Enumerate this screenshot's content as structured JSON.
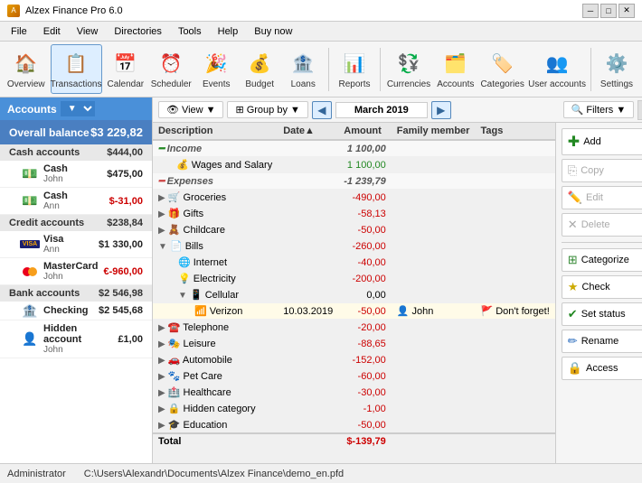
{
  "titleBar": {
    "title": "Alzex Finance Pro 6.0",
    "icon": "A",
    "controls": [
      "─",
      "□",
      "✕"
    ]
  },
  "menuBar": {
    "items": [
      "File",
      "Edit",
      "View",
      "Directories",
      "Tools",
      "Help",
      "Buy now"
    ]
  },
  "toolbar": {
    "buttons": [
      {
        "id": "overview",
        "label": "Overview",
        "icon": "🏠"
      },
      {
        "id": "transactions",
        "label": "Transactions",
        "icon": "📋",
        "active": true
      },
      {
        "id": "calendar",
        "label": "Calendar",
        "icon": "📅"
      },
      {
        "id": "scheduler",
        "label": "Scheduler",
        "icon": "⏰"
      },
      {
        "id": "events",
        "label": "Events",
        "icon": "🎉"
      },
      {
        "id": "budget",
        "label": "Budget",
        "icon": "💰"
      },
      {
        "id": "loans",
        "label": "Loans",
        "icon": "🏦"
      },
      {
        "id": "reports",
        "label": "Reports",
        "icon": "📊"
      },
      {
        "id": "currencies",
        "label": "Currencies",
        "icon": "💱"
      },
      {
        "id": "accounts",
        "label": "Accounts",
        "icon": "🗂️"
      },
      {
        "id": "categories",
        "label": "Categories",
        "icon": "🏷️"
      },
      {
        "id": "user-accounts",
        "label": "User accounts",
        "icon": "👥"
      },
      {
        "id": "settings",
        "label": "Settings",
        "icon": "⚙️"
      }
    ]
  },
  "leftPanel": {
    "accountsBtn": "Accounts",
    "overallBalance": {
      "label": "Overall balance",
      "amount": "$3 229,82"
    },
    "groups": [
      {
        "name": "Cash accounts",
        "total": "$444,00",
        "accounts": [
          {
            "name": "Cash",
            "sub": "John",
            "balance": "$475,00",
            "icon": "💵",
            "negative": false
          },
          {
            "name": "Cash",
            "sub": "Ann",
            "balance": "$-31,00",
            "icon": "💵",
            "negative": true
          }
        ]
      },
      {
        "name": "Credit accounts",
        "total": "$238,84",
        "accounts": [
          {
            "name": "Visa",
            "sub": "Ann",
            "balance": "$1 330,00",
            "icon": "visa",
            "negative": false
          },
          {
            "name": "MasterCard",
            "sub": "John",
            "balance": "€-960,00",
            "icon": "mc",
            "negative": true
          }
        ]
      },
      {
        "name": "Bank accounts",
        "total": "$2 546,98",
        "accounts": [
          {
            "name": "Checking",
            "sub": "",
            "balance": "$2 545,68",
            "icon": "🏦",
            "negative": false
          },
          {
            "name": "Hidden account",
            "sub": "John",
            "balance": "£1,00",
            "icon": "👤",
            "negative": false
          }
        ]
      }
    ]
  },
  "rightToolbar": {
    "viewBtn": "View",
    "groupByBtn": "Group by",
    "prevBtn": "◀",
    "nextBtn": "▶",
    "month": "March 2019",
    "filtersBtn": "Filters",
    "toggleBtn": "▦"
  },
  "table": {
    "columns": [
      "Description",
      "Date▲",
      "Amount",
      "Family member",
      "Tags"
    ],
    "rows": [
      {
        "type": "group",
        "desc": "Income",
        "amount": "1 100,00",
        "positive": true,
        "indent": 0
      },
      {
        "type": "normal",
        "desc": "Wages and Salary",
        "amount": "1 100,00",
        "positive": true,
        "indent": 1,
        "icon": "💰"
      },
      {
        "type": "group",
        "desc": "Expenses",
        "amount": "-1 239,79",
        "positive": false,
        "indent": 0
      },
      {
        "type": "expand",
        "desc": "Groceries",
        "amount": "-490,00",
        "positive": false,
        "indent": 1,
        "icon": "🛒"
      },
      {
        "type": "expand",
        "desc": "Gifts",
        "amount": "-58,13",
        "positive": false,
        "indent": 1,
        "icon": "🎁"
      },
      {
        "type": "expand",
        "desc": "Childcare",
        "amount": "-50,00",
        "positive": false,
        "indent": 1,
        "icon": "🧸"
      },
      {
        "type": "expand-open",
        "desc": "Bills",
        "amount": "-260,00",
        "positive": false,
        "indent": 1,
        "icon": "📄"
      },
      {
        "type": "normal",
        "desc": "Internet",
        "amount": "-40,00",
        "positive": false,
        "indent": 2,
        "icon": "🌐"
      },
      {
        "type": "normal",
        "desc": "Electricity",
        "amount": "-200,00",
        "positive": false,
        "indent": 2,
        "icon": "💡"
      },
      {
        "type": "expand-open",
        "desc": "Cellular",
        "amount": "0,00",
        "positive": false,
        "indent": 2,
        "icon": "📱"
      },
      {
        "type": "sub",
        "desc": "Verizon",
        "date": "10.03.2019",
        "amount": "-50,00",
        "positive": false,
        "indent": 3,
        "icon": "📶",
        "member": "John",
        "tag": "🚩 Don't forget!"
      },
      {
        "type": "expand",
        "desc": "Telephone",
        "amount": "-20,00",
        "positive": false,
        "indent": 1,
        "icon": "☎️"
      },
      {
        "type": "expand",
        "desc": "Leisure",
        "amount": "-88,65",
        "positive": false,
        "indent": 1,
        "icon": "🎭"
      },
      {
        "type": "expand",
        "desc": "Automobile",
        "amount": "-152,00",
        "positive": false,
        "indent": 1,
        "icon": "🚗"
      },
      {
        "type": "expand",
        "desc": "Pet Care",
        "amount": "-60,00",
        "positive": false,
        "indent": 1,
        "icon": "🐾"
      },
      {
        "type": "expand",
        "desc": "Healthcare",
        "amount": "-30,00",
        "positive": false,
        "indent": 1,
        "icon": "🏥"
      },
      {
        "type": "expand",
        "desc": "Hidden category",
        "amount": "-1,00",
        "positive": false,
        "indent": 1,
        "icon": "🔒"
      },
      {
        "type": "expand",
        "desc": "Education",
        "amount": "-50,00",
        "positive": false,
        "indent": 1,
        "icon": "🎓"
      }
    ],
    "total": {
      "label": "Total",
      "amount": "$-139,79"
    }
  },
  "actionPanel": {
    "add": "Add",
    "copy": "Copy",
    "edit": "Edit",
    "delete": "Delete",
    "categorize": "Categorize",
    "check": "Check",
    "setStatus": "Set status",
    "rename": "Rename",
    "access": "Access"
  },
  "statusBar": {
    "user": "Administrator",
    "path": "C:\\Users\\Alexandr\\Documents\\Alzex Finance\\demo_en.pfd"
  }
}
